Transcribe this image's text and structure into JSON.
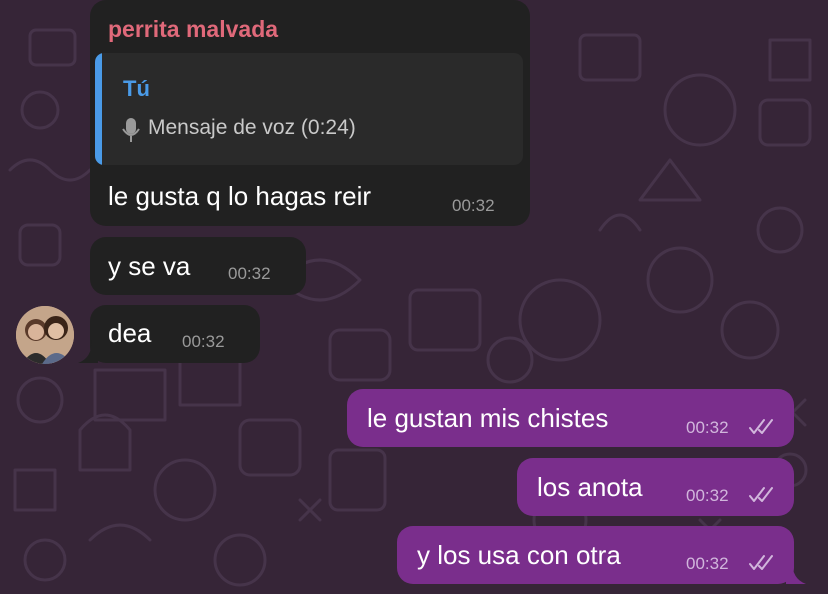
{
  "chat": {
    "incoming_sender": "perrita malvada",
    "reply": {
      "author": "Tú",
      "preview": "Mensaje de voz (0:24)",
      "icon": "microphone-icon"
    },
    "incoming_messages": [
      {
        "text": "le gusta q lo hagas reir",
        "time": "00:32"
      },
      {
        "text": "y se va",
        "time": "00:32"
      },
      {
        "text": "dea",
        "time": "00:32"
      }
    ],
    "outgoing_messages": [
      {
        "text": "le gustan mis chistes",
        "time": "00:32",
        "status": "read-double-check"
      },
      {
        "text": "los anota",
        "time": "00:32",
        "status": "read-double-check"
      },
      {
        "text": "y los usa con otra",
        "time": "00:32",
        "status": "read-double-check"
      }
    ]
  },
  "colors": {
    "background": "#362537",
    "incoming_bubble": "#212121",
    "outgoing_bubble": "#7a2e8c",
    "sender_name": "#e0697a",
    "reply_accent": "#4a9be8"
  }
}
